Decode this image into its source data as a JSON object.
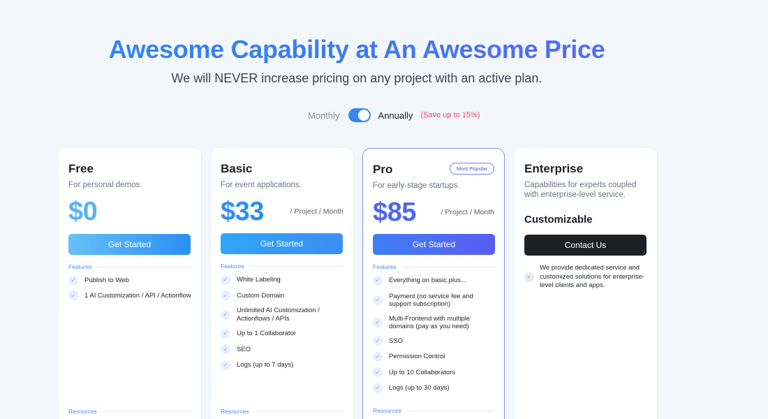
{
  "header": {
    "title": "Awesome Capability at An Awesome Price",
    "subtitle": "We will NEVER increase pricing on any project with an active plan."
  },
  "billing": {
    "monthly_label": "Monthly",
    "annually_label": "Annually",
    "save_note": "(Save up to 15%)",
    "annual_selected": true
  },
  "colors": {
    "accent": "#3a85f5",
    "pro_border": "#8b93f5",
    "save_note": "#e8456a"
  },
  "plans": {
    "free": {
      "name": "Free",
      "description": "For personal demos.",
      "price": "$0",
      "cta": "Get Started",
      "features_label": "Features",
      "features": [
        "Publish to Web",
        "1 AI Customization / API / Actionflow"
      ],
      "resources_label": "Resources"
    },
    "basic": {
      "name": "Basic",
      "description": "For event applications.",
      "price": "$33",
      "period": "/ Project / Month",
      "cta": "Get Started",
      "features_label": "Features",
      "features": [
        "White Labeling",
        "Custom Domain",
        "Unlimited AI Customization / Actionflows / APIs",
        "Up to 1 Collaborator",
        "SEO",
        "Logs (up to 7 days)"
      ],
      "resources_label": "Resources"
    },
    "pro": {
      "name": "Pro",
      "badge": "Most Popular",
      "description": "For early-stage startups.",
      "price": "$85",
      "period": "/ Project / Month",
      "cta": "Get Started",
      "features_label": "Features",
      "features": [
        "Everything on basic plus...",
        "Payment (no service fee and support subscription)",
        "Multi-Frontend with multiple domains (pay as you need)",
        "SSO",
        "Permission Control",
        "Up to 10 Collaborators",
        "Logs (up to 30 days)"
      ],
      "resources_label": "Resources"
    },
    "enterprise": {
      "name": "Enterprise",
      "description": "Capabilities for experts coupled with enterprise-level service.",
      "price_label": "Customizable",
      "cta": "Contact Us",
      "note": "We provide dedicated service and customized solutions for enterprise-level clients and apps."
    }
  },
  "icons": {
    "feature_check": "check-icon",
    "toggle": "toggle-switch"
  }
}
